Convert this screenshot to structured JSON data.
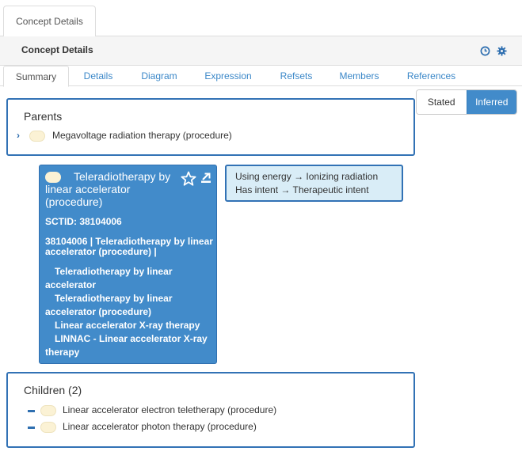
{
  "window": {
    "tab_label": "Concept Details"
  },
  "panel": {
    "title": "Concept Details",
    "icons": [
      "history-icon",
      "gear-icon"
    ]
  },
  "nav": {
    "tabs": [
      {
        "label": "Summary",
        "active": true
      },
      {
        "label": "Details"
      },
      {
        "label": "Diagram"
      },
      {
        "label": "Expression"
      },
      {
        "label": "Refsets"
      },
      {
        "label": "Members"
      },
      {
        "label": "References"
      }
    ]
  },
  "view_toggle": {
    "stated": "Stated",
    "inferred": "Inferred",
    "selected": "Inferred"
  },
  "parents": {
    "title": "Parents",
    "items": [
      {
        "label": "Megavoltage radiation therapy (procedure)"
      }
    ]
  },
  "concept": {
    "title": "Teleradiotherapy by linear accelerator (procedure)",
    "sctid": "SCTID: 38104006",
    "fsn": "38104006 | Teleradiotherapy by linear accelerator (procedure) |",
    "synonyms": [
      "Teleradiotherapy by linear accelerator",
      "Teleradiotherapy by linear accelerator (procedure)",
      "Linear accelerator X-ray therapy",
      "LINNAC - Linear accelerator X-ray therapy"
    ]
  },
  "attributes": [
    {
      "type": "Using energy",
      "arrow": "→",
      "value": "Ionizing radiation"
    },
    {
      "type": "Has intent",
      "arrow": "→",
      "value": "Therapeutic intent"
    }
  ],
  "children": {
    "title": "Children (2)",
    "items": [
      {
        "label": "Linear accelerator electron teletherapy (procedure)"
      },
      {
        "label": "Linear accelerator photon therapy (procedure)"
      }
    ]
  },
  "colors": {
    "accent": "#428bca",
    "border": "#3272b5",
    "attr_bg": "#d9edf7",
    "pill": "#fbf2d5"
  }
}
